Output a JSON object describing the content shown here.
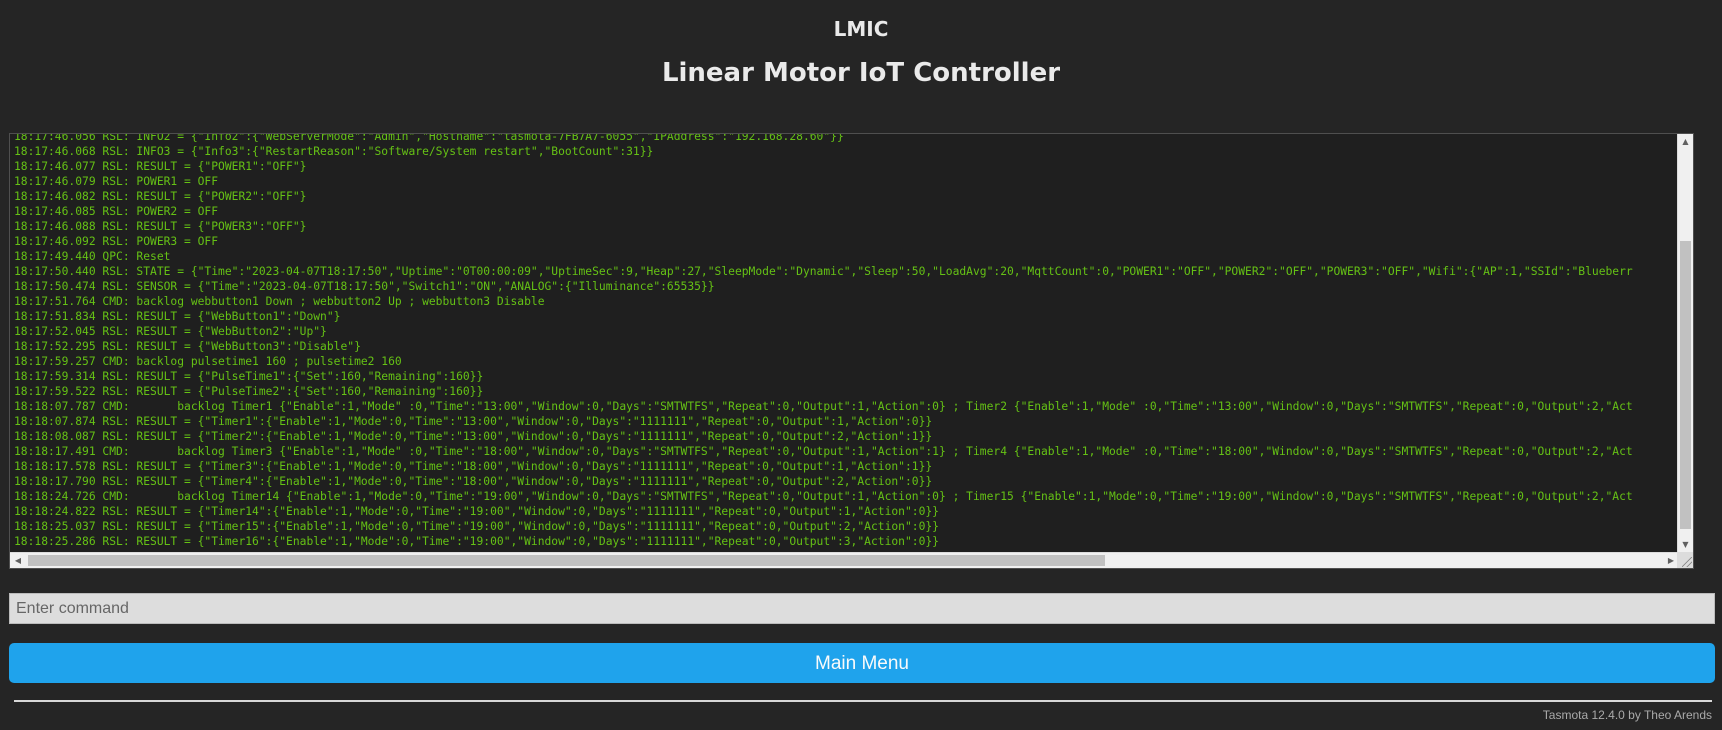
{
  "header": {
    "device_name": "LMIC",
    "title": "Linear Motor IoT Controller"
  },
  "console": {
    "lines": [
      "18:17:46.056 RSL: INFO2 = {\"Info2\":{\"WebServerMode\":\"Admin\",\"Hostname\":\"tasmota-7FB7A7-6055\",\"IPAddress\":\"192.168.28.60\"}}",
      "18:17:46.068 RSL: INFO3 = {\"Info3\":{\"RestartReason\":\"Software/System restart\",\"BootCount\":31}}",
      "18:17:46.077 RSL: RESULT = {\"POWER1\":\"OFF\"}",
      "18:17:46.079 RSL: POWER1 = OFF",
      "18:17:46.082 RSL: RESULT = {\"POWER2\":\"OFF\"}",
      "18:17:46.085 RSL: POWER2 = OFF",
      "18:17:46.088 RSL: RESULT = {\"POWER3\":\"OFF\"}",
      "18:17:46.092 RSL: POWER3 = OFF",
      "18:17:49.440 QPC: Reset",
      "18:17:50.440 RSL: STATE = {\"Time\":\"2023-04-07T18:17:50\",\"Uptime\":\"0T00:00:09\",\"UptimeSec\":9,\"Heap\":27,\"SleepMode\":\"Dynamic\",\"Sleep\":50,\"LoadAvg\":20,\"MqttCount\":0,\"POWER1\":\"OFF\",\"POWER2\":\"OFF\",\"POWER3\":\"OFF\",\"Wifi\":{\"AP\":1,\"SSId\":\"Blueberr",
      "18:17:50.474 RSL: SENSOR = {\"Time\":\"2023-04-07T18:17:50\",\"Switch1\":\"ON\",\"ANALOG\":{\"Illuminance\":65535}}",
      "18:17:51.764 CMD: backlog webbutton1 Down ; webbutton2 Up ; webbutton3 Disable",
      "18:17:51.834 RSL: RESULT = {\"WebButton1\":\"Down\"}",
      "18:17:52.045 RSL: RESULT = {\"WebButton2\":\"Up\"}",
      "18:17:52.295 RSL: RESULT = {\"WebButton3\":\"Disable\"}",
      "18:17:59.257 CMD: backlog pulsetime1 160 ; pulsetime2 160",
      "18:17:59.314 RSL: RESULT = {\"PulseTime1\":{\"Set\":160,\"Remaining\":160}}",
      "18:17:59.522 RSL: RESULT = {\"PulseTime2\":{\"Set\":160,\"Remaining\":160}}",
      "18:18:07.787 CMD:       backlog Timer1 {\"Enable\":1,\"Mode\" :0,\"Time\":\"13:00\",\"Window\":0,\"Days\":\"SMTWTFS\",\"Repeat\":0,\"Output\":1,\"Action\":0} ; Timer2 {\"Enable\":1,\"Mode\" :0,\"Time\":\"13:00\",\"Window\":0,\"Days\":\"SMTWTFS\",\"Repeat\":0,\"Output\":2,\"Act",
      "18:18:07.874 RSL: RESULT = {\"Timer1\":{\"Enable\":1,\"Mode\":0,\"Time\":\"13:00\",\"Window\":0,\"Days\":\"1111111\",\"Repeat\":0,\"Output\":1,\"Action\":0}}",
      "18:18:08.087 RSL: RESULT = {\"Timer2\":{\"Enable\":1,\"Mode\":0,\"Time\":\"13:00\",\"Window\":0,\"Days\":\"1111111\",\"Repeat\":0,\"Output\":2,\"Action\":1}}",
      "18:18:17.491 CMD:       backlog Timer3 {\"Enable\":1,\"Mode\" :0,\"Time\":\"18:00\",\"Window\":0,\"Days\":\"SMTWTFS\",\"Repeat\":0,\"Output\":1,\"Action\":1} ; Timer4 {\"Enable\":1,\"Mode\" :0,\"Time\":\"18:00\",\"Window\":0,\"Days\":\"SMTWTFS\",\"Repeat\":0,\"Output\":2,\"Act",
      "18:18:17.578 RSL: RESULT = {\"Timer3\":{\"Enable\":1,\"Mode\":0,\"Time\":\"18:00\",\"Window\":0,\"Days\":\"1111111\",\"Repeat\":0,\"Output\":1,\"Action\":1}}",
      "18:18:17.790 RSL: RESULT = {\"Timer4\":{\"Enable\":1,\"Mode\":0,\"Time\":\"18:00\",\"Window\":0,\"Days\":\"1111111\",\"Repeat\":0,\"Output\":2,\"Action\":0}}",
      "18:18:24.726 CMD:       backlog Timer14 {\"Enable\":1,\"Mode\":0,\"Time\":\"19:00\",\"Window\":0,\"Days\":\"SMTWTFS\",\"Repeat\":0,\"Output\":1,\"Action\":0} ; Timer15 {\"Enable\":1,\"Mode\":0,\"Time\":\"19:00\",\"Window\":0,\"Days\":\"SMTWTFS\",\"Repeat\":0,\"Output\":2,\"Act",
      "18:18:24.822 RSL: RESULT = {\"Timer14\":{\"Enable\":1,\"Mode\":0,\"Time\":\"19:00\",\"Window\":0,\"Days\":\"1111111\",\"Repeat\":0,\"Output\":1,\"Action\":0}}",
      "18:18:25.037 RSL: RESULT = {\"Timer15\":{\"Enable\":1,\"Mode\":0,\"Time\":\"19:00\",\"Window\":0,\"Days\":\"1111111\",\"Repeat\":0,\"Output\":2,\"Action\":0}}",
      "18:18:25.286 RSL: RESULT = {\"Timer16\":{\"Enable\":1,\"Mode\":0,\"Time\":\"19:00\",\"Window\":0,\"Days\":\"1111111\",\"Repeat\":0,\"Output\":3,\"Action\":0}}"
    ],
    "text_color": "#65c115",
    "scroll_arrows": {
      "up": "▲",
      "down": "▼",
      "left": "◀",
      "right": "▶"
    }
  },
  "command": {
    "placeholder": "Enter command",
    "value": ""
  },
  "main_menu_button": {
    "label": "Main Menu",
    "color": "#1fa3ec"
  },
  "footer": {
    "text": "Tasmota 12.4.0 by Theo Arends"
  },
  "theme": {
    "background": "#252525",
    "text": "#eaeaea"
  }
}
